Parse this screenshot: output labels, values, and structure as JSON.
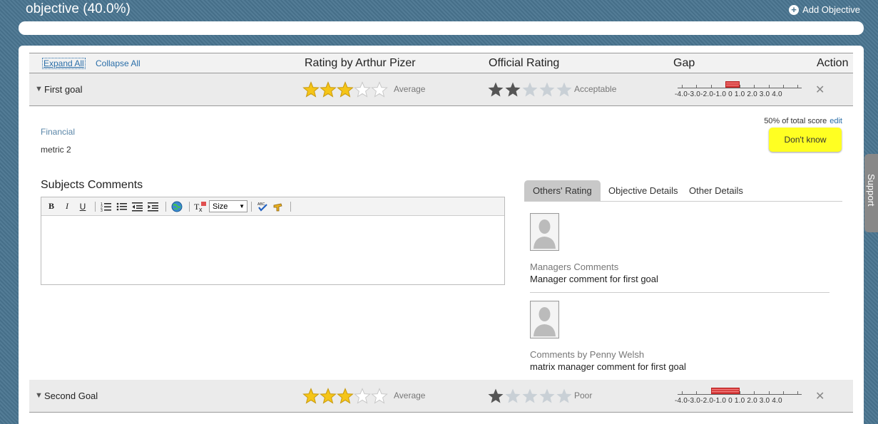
{
  "header": {
    "title": "objective (40.0%)",
    "add_objective": "Add Objective"
  },
  "table": {
    "expand_all": "Expand All",
    "collapse_all": "Collapse All",
    "col_rating_by": "Rating by Arthur Pizer",
    "col_official": "Official Rating",
    "col_gap": "Gap",
    "col_action": "Action"
  },
  "gap_scale_labels": "-4.0-3.0-2.0-1.0  0   1.0  2.0  3.0  4.0",
  "goals": [
    {
      "name": "First goal",
      "self_rating_stars": 3,
      "self_rating_label": "Average",
      "official_rating_stars": 2,
      "official_rating_label": "Acceptable",
      "gap_from": -1.0,
      "gap_to": 0
    },
    {
      "name": "Second Goal",
      "self_rating_stars": 3,
      "self_rating_label": "Average",
      "official_rating_stars": 1,
      "official_rating_label": "Poor",
      "gap_from": -2.0,
      "gap_to": 0
    }
  ],
  "detail": {
    "category": "Financial",
    "metric": "metric 2",
    "score_share": "50% of total score",
    "edit_label": "edit",
    "dont_know": "Don't know",
    "subjects_comments": "Subjects Comments",
    "size_select": "Size"
  },
  "tabs": [
    "Others' Rating",
    "Objective Details",
    "Other Details"
  ],
  "comments": [
    {
      "label": "Managers Comments",
      "text": "Manager comment for first goal"
    },
    {
      "label": "Comments by Penny Welsh",
      "text": "matrix manager comment for first goal"
    }
  ],
  "support": "Support",
  "colors": {
    "background": "#4a7590",
    "star_gold": "#f5c518",
    "star_gray": "#555555",
    "dont_know": "#ffff22",
    "link": "#2a6ea8"
  }
}
